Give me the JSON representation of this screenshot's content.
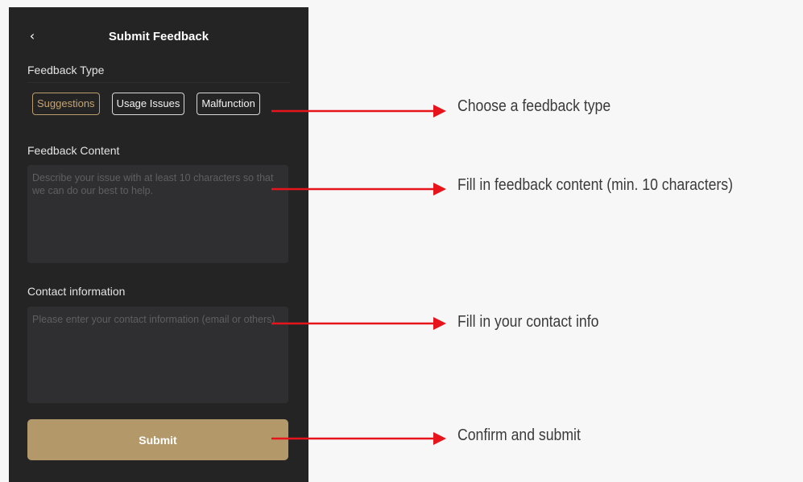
{
  "header": {
    "back_icon": "chevron-left-icon",
    "title": "Submit Feedback"
  },
  "feedback_type": {
    "label": "Feedback Type",
    "options": [
      "Suggestions",
      "Usage Issues",
      "Malfunction"
    ],
    "selected": "Suggestions"
  },
  "feedback_content": {
    "label": "Feedback Content",
    "placeholder": "Describe your issue with at least 10 characters so that we can do our best to help."
  },
  "contact": {
    "label": "Contact information",
    "placeholder": "Please enter your contact information (email or others)"
  },
  "submit_label": "Submit",
  "annotations": [
    "Choose a feedback type",
    "Fill in feedback content (min. 10 characters)",
    "Fill in your contact info",
    "Confirm and submit"
  ],
  "colors": {
    "panel_bg": "#242424",
    "accent_gold": "#b3986a",
    "selected_chip": "#c6a470",
    "arrow_red": "#e8141c",
    "page_bg": "#f7f7f7"
  }
}
